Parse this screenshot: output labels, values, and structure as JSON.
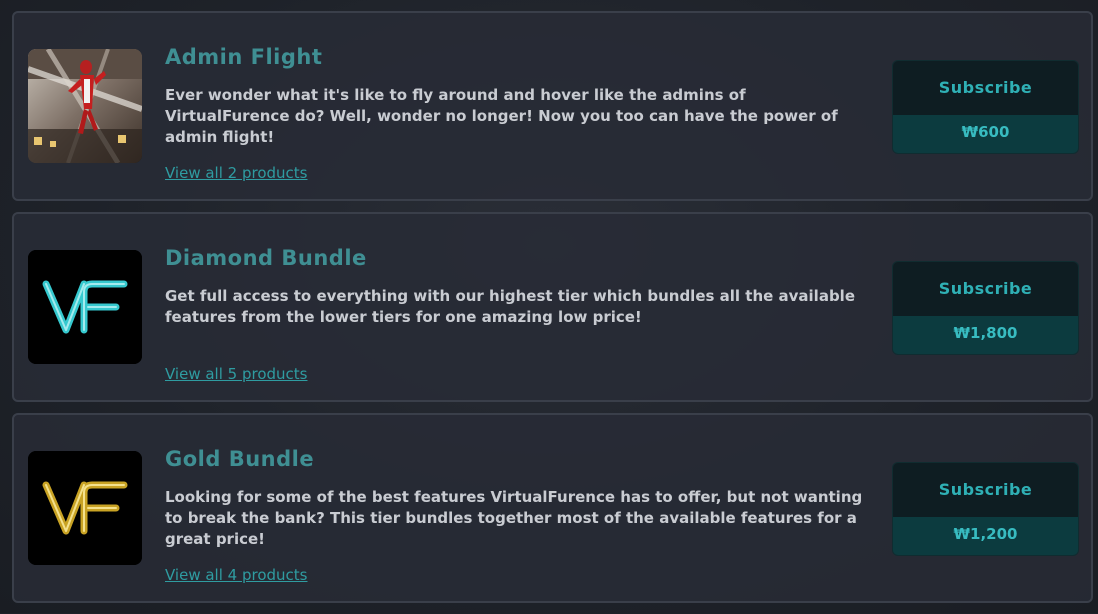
{
  "products": [
    {
      "title": "Admin Flight",
      "description": "Ever wonder what it's like to fly around and hover like the admins of VirtualFurence do? Well, wonder no longer! Now you too can have the power of admin flight!",
      "view_link": "View all 2 products",
      "subscribe_label": "Subscribe",
      "price": "₩600",
      "thumbnail": "avatar-flying-image"
    },
    {
      "title": "Diamond Bundle",
      "description": "Get full access to everything with our highest tier which bundles all the available features from the lower tiers for one amazing low price!",
      "view_link": "View all 5 products",
      "subscribe_label": "Subscribe",
      "price": "₩1,800",
      "thumbnail": "vf-diamond-logo",
      "accent": "#36c9cf"
    },
    {
      "title": "Gold Bundle",
      "description": "Looking for some of the best features VirtualFurence has to offer, but not wanting to break the bank? This tier bundles together most of the available features for a great price!",
      "view_link": "View all 4 products",
      "subscribe_label": "Subscribe",
      "price": "₩1,200",
      "thumbnail": "vf-gold-logo",
      "accent": "#d4b12a"
    }
  ],
  "colors": {
    "title": "#3f8f93",
    "link": "#2f9ca1",
    "subscribe_bg": "#0e1d22",
    "price_bg": "#0c3b3f"
  }
}
